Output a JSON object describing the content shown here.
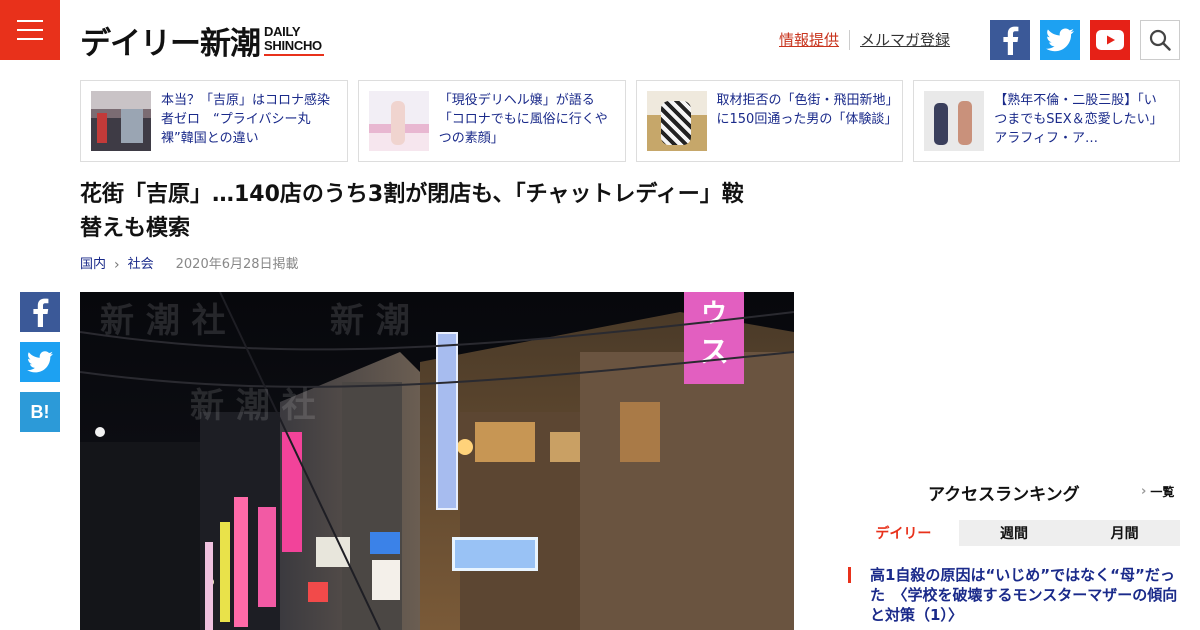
{
  "header": {
    "logo_jp": "デイリー新潮",
    "logo_en_1": "DAILY",
    "logo_en_2": "SHINCHO",
    "link_info": "情報提供",
    "link_magazine": "メルマガ登録"
  },
  "related": [
    {
      "title": "本当？「吉原」はコロナ感染者ゼロ　“プライバシー丸裸”韓国との違い"
    },
    {
      "title": "「現役デリヘル嬢」が語る「コロナでもに風俗に行くやつの素顔」"
    },
    {
      "title": "取材拒否の「色街・飛田新地」に150回通った男の「体験談」"
    },
    {
      "title": "【熟年不倫・二股三股】「いつまでもSEX＆恋愛したい」アラフィフ・ア…"
    }
  ],
  "article": {
    "headline": "花街「吉原」…140店のうち3割が閉店も、「チャットレディー」鞍替えも模索",
    "category_1": "国内",
    "category_2": "社会",
    "date": "2020年6月28日掲載"
  },
  "share": {
    "hatena_label": "B!"
  },
  "ranking": {
    "title": "アクセスランキング",
    "more": "一覧",
    "tabs": [
      "デイリー",
      "週間",
      "月間"
    ],
    "first_item": "高1自殺の原因は“いじめ”ではなく“母”だった　〈学校を破壊するモンスターマザーの傾向と対策（1）〉"
  },
  "colors": {
    "brand_red": "#e8311b",
    "link_blue": "#1a2a8a",
    "facebook": "#3b5998",
    "twitter": "#1da1f2",
    "youtube": "#e62117",
    "hatena": "#2c9ad8"
  }
}
